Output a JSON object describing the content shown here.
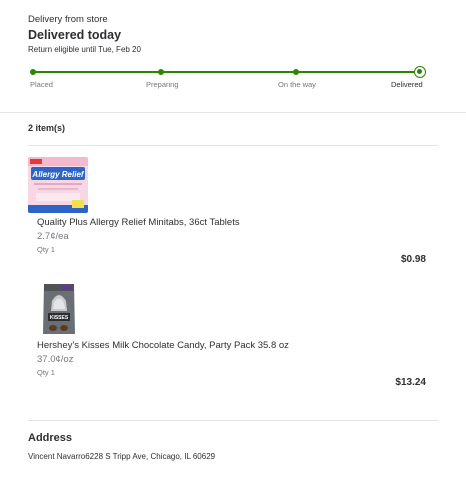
{
  "header": {
    "delivery_type": "Delivery from store",
    "status_title": "Delivered today",
    "return_note": "Return eligible until Tue, Feb 20"
  },
  "progress": {
    "steps": [
      {
        "label": "Placed",
        "done": true
      },
      {
        "label": "Preparing",
        "done": true
      },
      {
        "label": "On the way",
        "done": true
      },
      {
        "label": "Delivered",
        "done": true,
        "current": true
      }
    ],
    "color": "#2a8703"
  },
  "items_count": "2 item(s)",
  "items": [
    {
      "name": "Quality Plus Allergy Relief Minitabs, 36ct Tablets",
      "unit_price": "2.7¢/ea",
      "qty": "Qty 1",
      "price": "$0.98",
      "image_brand_text": "Allergy Relief"
    },
    {
      "name": "Hershey's Kisses Milk Chocolate Candy, Party Pack 35.8 oz",
      "unit_price": "37.0¢/oz",
      "qty": "Qty 1",
      "price": "$13.24",
      "image_brand_text": "KISSES"
    }
  ],
  "address": {
    "heading": "Address",
    "line": "Vincent Navarro6228 S Tripp Ave, Chicago, IL 60629"
  }
}
